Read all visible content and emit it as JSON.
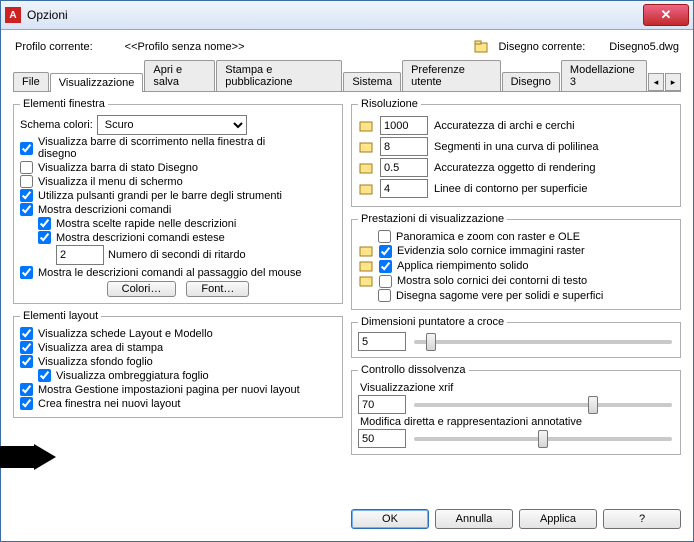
{
  "window": {
    "title": "Opzioni"
  },
  "profile": {
    "current_label": "Profilo corrente:",
    "current_value": "<<Profilo senza nome>>",
    "drawing_label": "Disegno corrente:",
    "drawing_value": "Disegno5.dwg"
  },
  "tabs": {
    "file": "File",
    "visual": "Visualizzazione",
    "open_save": "Apri e salva",
    "print": "Stampa e pubblicazione",
    "system": "Sistema",
    "user": "Preferenze utente",
    "draw": "Disegno",
    "model3d": "Modellazione 3"
  },
  "left": {
    "elem_window": {
      "legend": "Elementi finestra",
      "color_scheme_lbl": "Schema colori:",
      "color_scheme_val": "Scuro",
      "scrollbars": "Visualizza barre di scorrimento nella finestra di disegno",
      "statusbar": "Visualizza barra di stato Disegno",
      "screenmenu": "Visualizza il menu di schermo",
      "bigbuttons": "Utilizza pulsanti grandi per le barre degli strumenti",
      "tooltips": "Mostra descrizioni comandi",
      "shortcuts": "Mostra scelte rapide nelle descrizioni",
      "ext_tooltips": "Mostra descrizioni comandi estese",
      "delay_val": "2",
      "delay_lbl": "Numero di secondi di ritardo",
      "rollover": "Mostra le descrizioni comandi al passaggio del mouse",
      "colors_btn": "Colori…",
      "fonts_btn": "Font…"
    },
    "elem_layout": {
      "legend": "Elementi layout",
      "tabs_layout": "Visualizza schede Layout e Modello",
      "print_area": "Visualizza area di stampa",
      "paper_bg": "Visualizza sfondo foglio",
      "paper_shadow": "Visualizza ombreggiatura foglio",
      "page_setup": "Mostra Gestione impostazioni pagina per nuovi layout",
      "make_viewport": "Crea finestra nei nuovi layout"
    }
  },
  "right": {
    "resolution": {
      "legend": "Risoluzione",
      "arc_val": "1000",
      "arc_lbl": "Accuratezza di archi e cerchi",
      "poly_val": "8",
      "poly_lbl": "Segmenti in una curva di polilinea",
      "render_val": "0.5",
      "render_lbl": "Accuratezza oggetto di rendering",
      "surf_val": "4",
      "surf_lbl": "Linee di contorno per superficie"
    },
    "perf": {
      "legend": "Prestazioni di visualizzazione",
      "pan_zoom": "Panoramica e zoom con raster e OLE",
      "highlight_raster": "Evidenzia solo cornice immagini raster",
      "solid_fill": "Applica riempimento solido",
      "text_frame": "Mostra solo cornici dei contorni di testo",
      "silhouettes": "Disegna sagome vere per solidi e superfici"
    },
    "crosshair": {
      "legend": "Dimensioni puntatore a croce",
      "val": "5"
    },
    "fade": {
      "legend": "Controllo dissolvenza",
      "xref_lbl": "Visualizzazione xrif",
      "xref_val": "70",
      "edit_lbl": "Modifica diretta e rappresentazioni annotative",
      "edit_val": "50"
    }
  },
  "footer": {
    "ok": "OK",
    "cancel": "Annulla",
    "apply": "Applica",
    "help": "?"
  }
}
